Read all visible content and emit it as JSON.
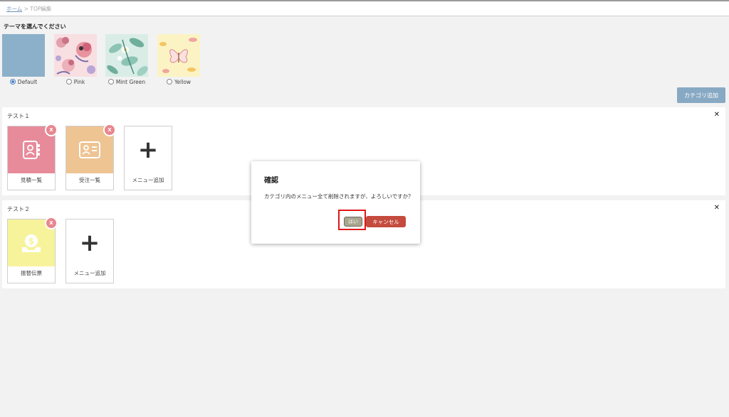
{
  "breadcrumb": {
    "home": "ホーム",
    "separator": ">",
    "current": "TOP編集"
  },
  "theme_prompt": "テーマを選んでください",
  "themes": [
    {
      "label": "Default",
      "selected": true
    },
    {
      "label": "Pink",
      "selected": false
    },
    {
      "label": "Mint Green",
      "selected": false
    },
    {
      "label": "Yellow",
      "selected": false
    }
  ],
  "add_category_label": "カテゴリ追加",
  "close_symbol": "✕",
  "remove_symbol": "X",
  "categories": [
    {
      "title": "テスト１",
      "tiles": [
        {
          "label": "見積一覧",
          "icon": "contact-book-icon",
          "color": "#e78b9b"
        },
        {
          "label": "受注一覧",
          "icon": "id-card-icon",
          "color": "#eec493"
        }
      ],
      "add_menu_label": "メニュー追加"
    },
    {
      "title": "テスト２",
      "tiles": [
        {
          "label": "振替伝票",
          "icon": "money-bag-icon",
          "color": "#f7f39b"
        }
      ],
      "add_menu_label": "メニュー追加"
    }
  ],
  "dialog": {
    "title": "確認",
    "message": "カテゴリ内のメニュー全て削除されますが、よろしいですか？",
    "yes_label": "はい",
    "cancel_label": "キャンセル"
  },
  "colors": {
    "accent": "#88a9c3",
    "remove_badge": "#e8868f",
    "cancel": "#c44b3e",
    "yes": "#a9a58f",
    "highlight": "#e01818"
  }
}
